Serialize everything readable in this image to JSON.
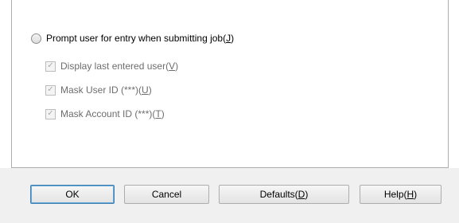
{
  "options": {
    "prompt_radio": {
      "label": "Prompt user for entry when submitting job",
      "mnemonic": "J"
    },
    "display_last": {
      "label": "Display last entered user",
      "mnemonic": "V"
    },
    "mask_user": {
      "label": "Mask User ID (***)",
      "mnemonic": "U"
    },
    "mask_account": {
      "label": "Mask Account ID (***)",
      "mnemonic": "T"
    }
  },
  "buttons": {
    "ok": "OK",
    "cancel": "Cancel",
    "defaults": {
      "label": "Defaults",
      "mnemonic": "D"
    },
    "help": {
      "label": "Help",
      "mnemonic": "H"
    }
  },
  "colors": {
    "disabled_text": "#6d6d6d",
    "footer_bg": "#f0f0f0",
    "default_button_border": "#3c7fb1"
  }
}
